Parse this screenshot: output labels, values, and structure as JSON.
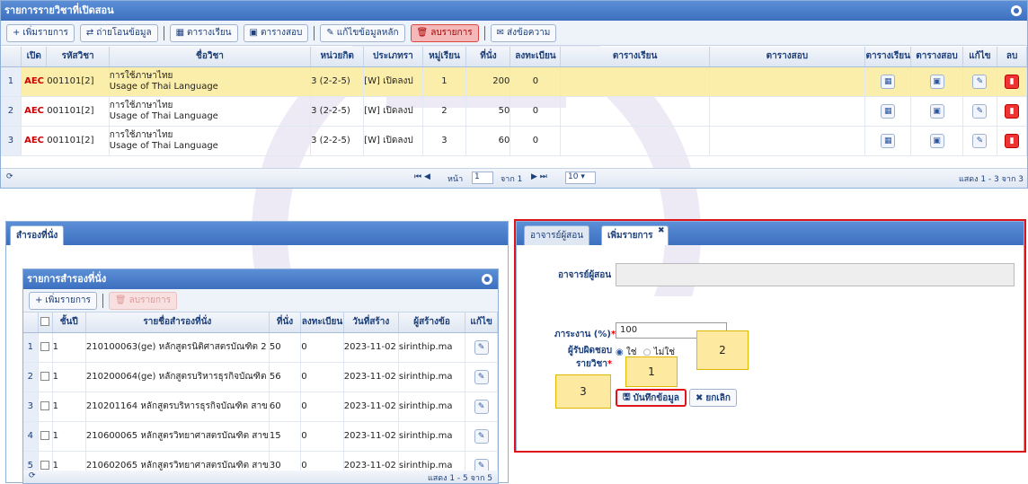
{
  "courses_panel": {
    "title": "รายการรายวิชาที่เปิดสอน",
    "toolbar": {
      "add": "เพิ่มรายการ",
      "transfer": "ถ่ายโอนข้อมูล",
      "timetable": "ตารางเรียน",
      "examtable": "ตารางสอบ",
      "edit_main": "แก้ไขข้อมูลหลัก",
      "delete": "ลบรายการ",
      "send_message": "ส่งข้อความ"
    },
    "columns": [
      "เปิด",
      "รหัสวิชา",
      "ชื่อวิชา",
      "หน่วยกิต",
      "ประเภทรา",
      "หมู่เรียน",
      "ที่นั่ง",
      "ลงทะเบียน",
      "ตารางเรียน",
      "ตารางสอบ",
      "ตารางเรียน",
      "ตารางสอบ",
      "แก้ไข",
      "ลบ"
    ],
    "rows": [
      {
        "no": "1",
        "tag": "AEC",
        "code": "001101[2]",
        "name_th": "การใช้ภาษาไทย",
        "name_en": "Usage of Thai Language",
        "credit": "3 (2-2-5)",
        "type": "[W] เปิดลงป",
        "section": "1",
        "seats": "200",
        "registered": "0"
      },
      {
        "no": "2",
        "tag": "AEC",
        "code": "001101[2]",
        "name_th": "การใช้ภาษาไทย",
        "name_en": "Usage of Thai Language",
        "credit": "3 (2-2-5)",
        "type": "[W] เปิดลงป",
        "section": "2",
        "seats": "50",
        "registered": "0"
      },
      {
        "no": "3",
        "tag": "AEC",
        "code": "001101[2]",
        "name_th": "การใช้ภาษาไทย",
        "name_en": "Usage of Thai Language",
        "credit": "3 (2-2-5)",
        "type": "[W] เปิดลงป",
        "section": "3",
        "seats": "60",
        "registered": "0"
      }
    ],
    "pager": {
      "page_label": "หน้า",
      "page": "1",
      "of": "จาก 1",
      "page_size": "10",
      "summary": "แสดง 1 - 3 จาก 3"
    }
  },
  "reserve_panel": {
    "tab": "สำรองที่นั่ง",
    "inner_title": "รายการสำรองที่นั่ง",
    "add": "เพิ่มรายการ",
    "delete": "ลบรายการ",
    "columns": [
      "ชั้นปี",
      "รายชื่อสำรองที่นั่ง",
      "ที่นั่ง",
      "ลงทะเบียน",
      "วันที่สร้าง",
      "ผู้สร้างข้อ",
      "แก้ไข"
    ],
    "rows": [
      {
        "no": "1",
        "year": "1",
        "name": "210100063(ge) หลักสูตรนิติศาสตรบัณฑิต 2",
        "seats": "50",
        "registered": "0",
        "created": "2023-11-02",
        "creator": "sirinthip.ma"
      },
      {
        "no": "2",
        "year": "1",
        "name": "210200064(ge) หลักสูตรบริหารธุรกิจบัณฑิต",
        "seats": "56",
        "registered": "0",
        "created": "2023-11-02",
        "creator": "sirinthip.ma"
      },
      {
        "no": "3",
        "year": "1",
        "name": "210201164 หลักสูตรบริหารธุรกิจบัณฑิต สาข",
        "seats": "60",
        "registered": "0",
        "created": "2023-11-02",
        "creator": "sirinthip.ma"
      },
      {
        "no": "4",
        "year": "1",
        "name": "210600065 หลักสูตรวิทยาศาสตรบัณฑิต สาข",
        "seats": "15",
        "registered": "0",
        "created": "2023-11-02",
        "creator": "sirinthip.ma"
      },
      {
        "no": "5",
        "year": "1",
        "name": "210602065 หลักสูตรวิทยาศาสตรบัณฑิต สาข",
        "seats": "30",
        "registered": "0",
        "created": "2023-11-02",
        "creator": "sirinthip.ma"
      }
    ],
    "summary": "แสดง 1 - 5 จาก 5"
  },
  "teacher_panel": {
    "tab1": "อาจารย์ผู้สอน",
    "tab2": "เพิ่มรายการ",
    "teacher_label": "อาจารย์ผู้สอน",
    "workload_label": "ภาระงาน (%)",
    "workload_value": "100",
    "responsible_label_1": "ผู้รับผิดชอบ",
    "responsible_label_2": "รายวิชา",
    "yes": "ใช่",
    "no": "ไม่ใช่",
    "save": "บันทึกข้อมูล",
    "cancel": "ยกเลิก"
  },
  "callouts": {
    "c1": "1",
    "c2": "2",
    "c3": "3"
  }
}
